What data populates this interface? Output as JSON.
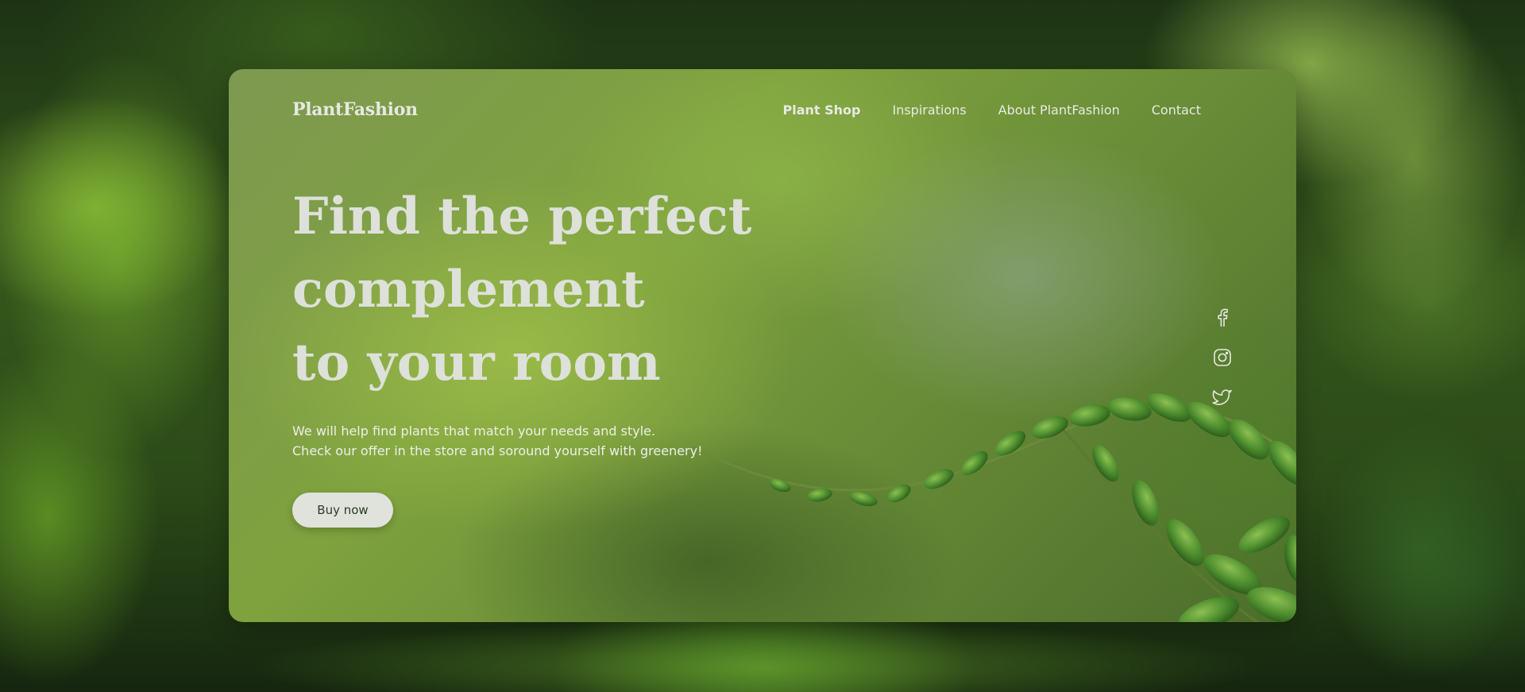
{
  "brand": {
    "logo": "PlantFashion"
  },
  "nav": {
    "items": [
      {
        "label": "Plant Shop",
        "active": true
      },
      {
        "label": "Inspirations",
        "active": false
      },
      {
        "label": "About PlantFashion",
        "active": false
      },
      {
        "label": "Contact",
        "active": false
      }
    ]
  },
  "hero": {
    "title_lines": [
      "Find the perfect",
      "complement",
      "to your room"
    ],
    "text_lines": [
      "We will help find plants that match your needs and style.",
      "Check our offer in the store and soround yourself with greenery!"
    ],
    "button_label": "Buy now"
  },
  "social": {
    "icons": [
      "facebook-icon",
      "instagram-icon",
      "twitter-icon"
    ]
  },
  "colors": {
    "text_light": "#dde1d9",
    "button_bg": "#dfe3db",
    "leaf_green": "#3f7a2a"
  }
}
